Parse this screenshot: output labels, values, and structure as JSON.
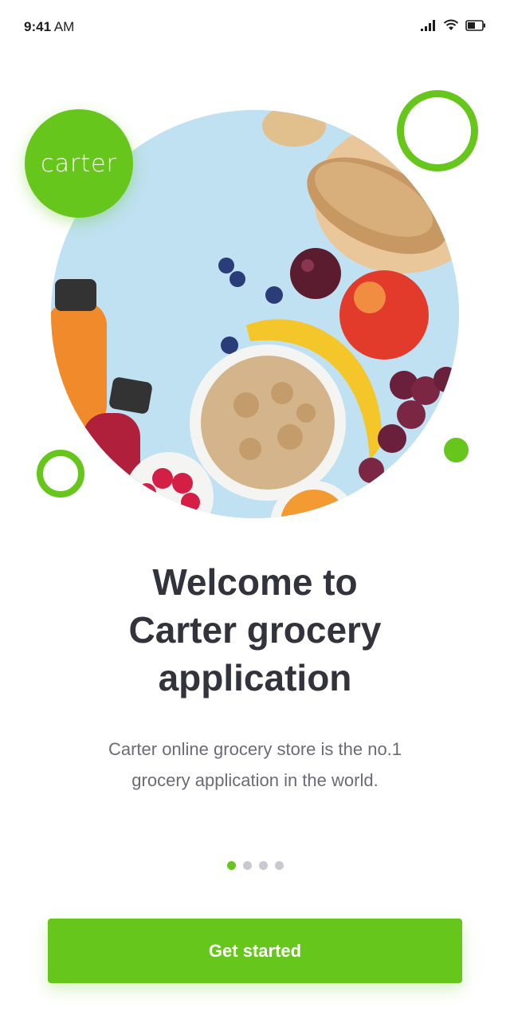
{
  "status_bar": {
    "time": "9:41",
    "meridiem": "AM"
  },
  "brand": {
    "logo_text": "carter",
    "accent_color": "#66c61c"
  },
  "onboarding": {
    "title_lines": [
      "Welcome to",
      "Carter grocery",
      "application"
    ],
    "description_lines": [
      "Carter online grocery store is the no.1",
      "grocery application in the world."
    ],
    "pages_total": 4,
    "current_page": 1
  },
  "actions": {
    "get_started_label": "Get started"
  },
  "icons": [
    "signal-icon",
    "wifi-icon",
    "battery-icon"
  ]
}
